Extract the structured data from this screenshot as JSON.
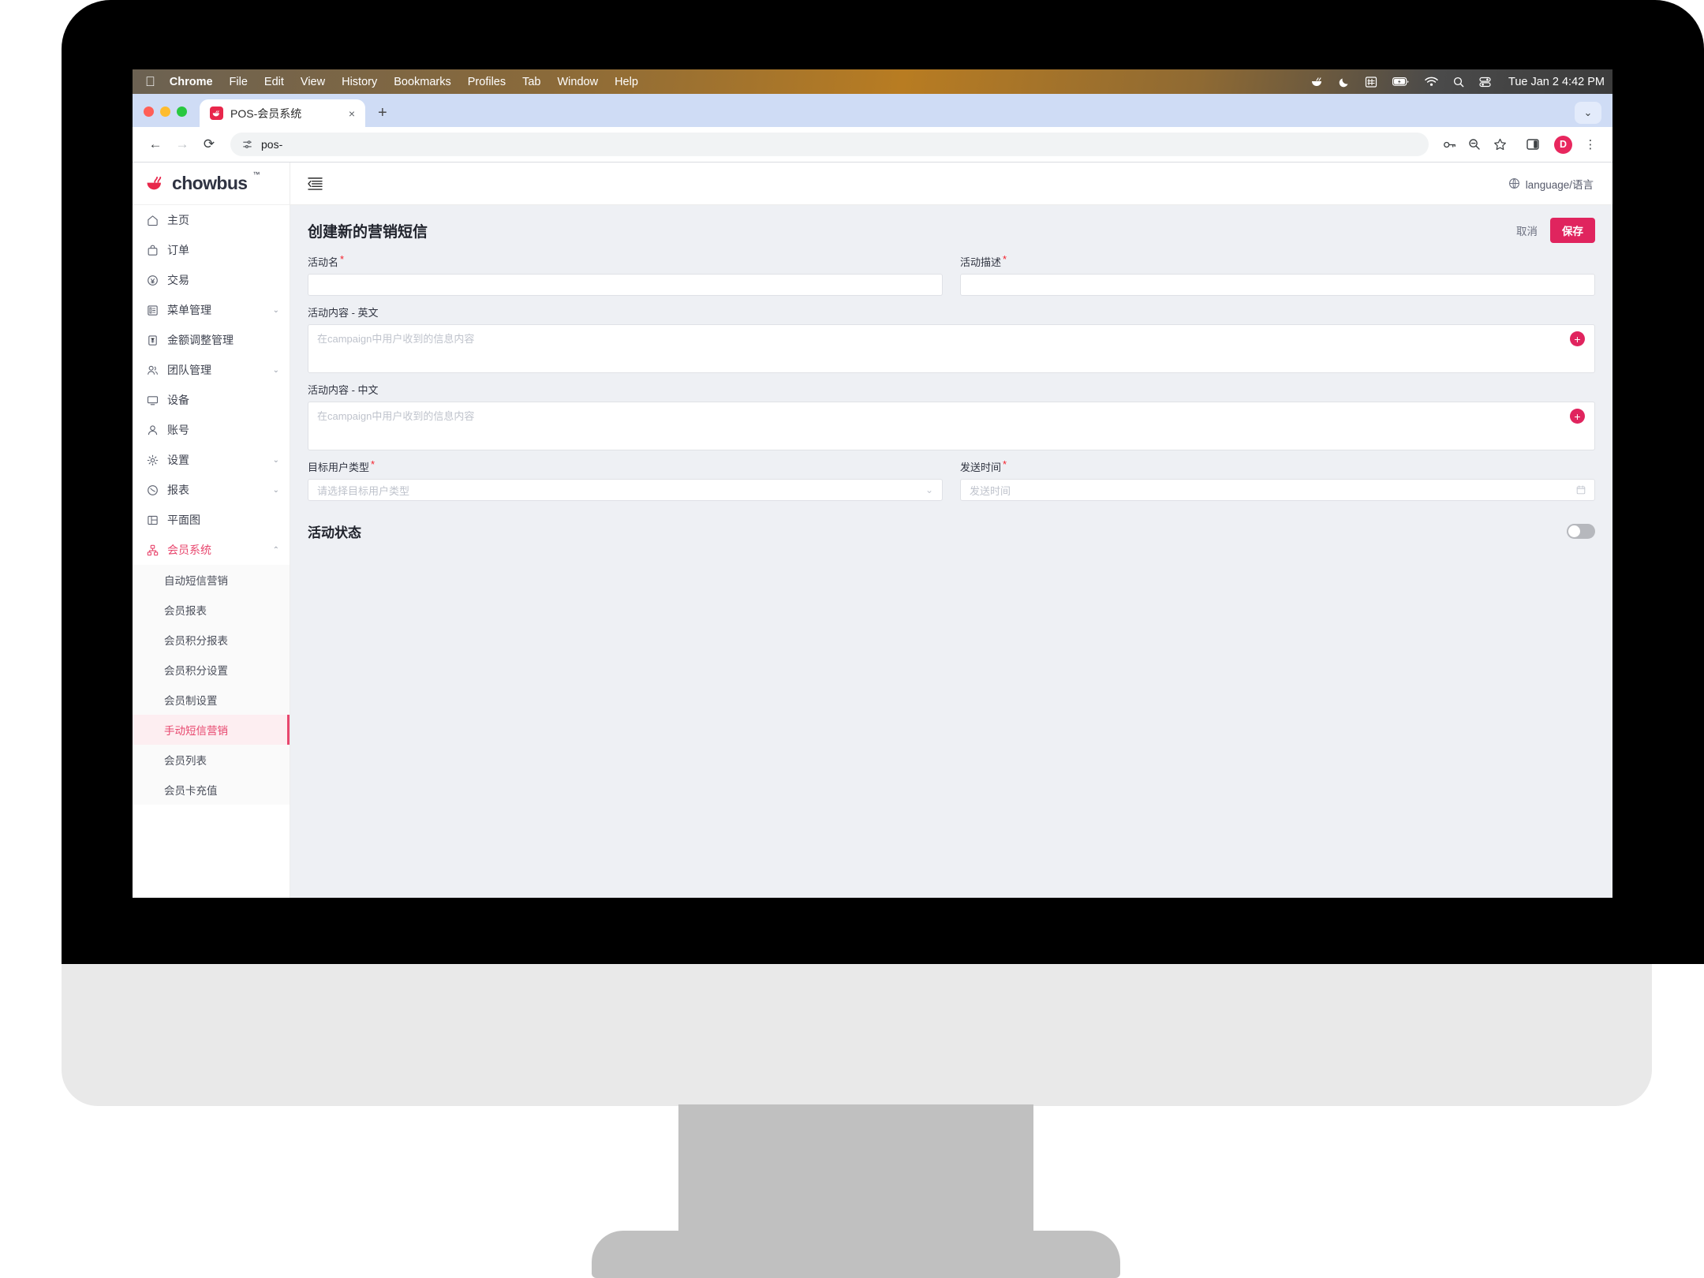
{
  "menubar": {
    "apple": "",
    "items": [
      "Chrome",
      "File",
      "Edit",
      "View",
      "History",
      "Bookmarks",
      "Profiles",
      "Tab",
      "Window",
      "Help"
    ],
    "status_icons": [
      "chowbus-menu-icon",
      "moon-icon",
      "input-source-icon",
      "battery-icon",
      "wifi-icon",
      "search-icon",
      "control-center-icon"
    ],
    "clock": "Tue Jan 2  4:42 PM"
  },
  "browser": {
    "tab": {
      "title": "POS-会员系统",
      "favicon": "chowbus-favicon",
      "close": "×"
    },
    "new_tab": "+",
    "tab_list_chevron": "⌄",
    "toolbar": {
      "back": "←",
      "forward": "→",
      "reload": "⟳",
      "site_info": "site-settings-icon",
      "url": "pos-",
      "password_icon": "key-icon",
      "zoom_icon": "zoom-out-icon",
      "bookmark_icon": "star-icon",
      "sidepanel_icon": "side-panel-icon",
      "avatar_letter": "D",
      "menu_icon": "⋮"
    }
  },
  "sidebar": {
    "logo": {
      "mark": "chowbus-bowl-icon",
      "word": "chowbus",
      "tm": "™"
    },
    "items": [
      {
        "label": "主页",
        "icon": "home-icon",
        "chevron": "",
        "active": false
      },
      {
        "label": "订单",
        "icon": "bag-icon",
        "chevron": "",
        "active": false
      },
      {
        "label": "交易",
        "icon": "transaction-icon",
        "chevron": "",
        "active": false
      },
      {
        "label": "菜单管理",
        "icon": "menu-list-icon",
        "chevron": "⌄",
        "active": false
      },
      {
        "label": "金额调整管理",
        "icon": "yuan-icon",
        "chevron": "",
        "active": false
      },
      {
        "label": "团队管理",
        "icon": "team-icon",
        "chevron": "⌄",
        "active": false
      },
      {
        "label": "设备",
        "icon": "monitor-icon",
        "chevron": "",
        "active": false
      },
      {
        "label": "账号",
        "icon": "user-icon",
        "chevron": "",
        "active": false
      },
      {
        "label": "设置",
        "icon": "gear-icon",
        "chevron": "⌄",
        "active": false
      },
      {
        "label": "报表",
        "icon": "report-icon",
        "chevron": "⌄",
        "active": false
      },
      {
        "label": "平面图",
        "icon": "layout-icon",
        "chevron": "",
        "active": false
      },
      {
        "label": "会员系统",
        "icon": "membership-icon",
        "chevron": "⌃",
        "active": true
      }
    ],
    "submenu": [
      {
        "label": "自动短信营销",
        "active": false
      },
      {
        "label": "会员报表",
        "active": false
      },
      {
        "label": "会员积分报表",
        "active": false
      },
      {
        "label": "会员积分设置",
        "active": false
      },
      {
        "label": "会员制设置",
        "active": false
      },
      {
        "label": "手动短信营销",
        "active": true
      },
      {
        "label": "会员列表",
        "active": false
      },
      {
        "label": "会员卡充值",
        "active": false
      }
    ]
  },
  "app_header": {
    "collapse_icon": "collapse-sidebar-icon",
    "language": "language/语言",
    "globe_icon": "globe-icon"
  },
  "form": {
    "page_title": "创建新的营销短信",
    "cancel_label": "取消",
    "save_label": "保存",
    "campaign_name": {
      "label": "活动名",
      "required": "*",
      "value": "",
      "placeholder": ""
    },
    "campaign_desc": {
      "label": "活动描述",
      "required": "*",
      "value": "",
      "placeholder": ""
    },
    "content_en": {
      "label": "活动内容 - 英文",
      "placeholder": "在campaign中用户收到的信息内容",
      "value": "",
      "add_icon": "+"
    },
    "content_zh": {
      "label": "活动内容 - 中文",
      "placeholder": "在campaign中用户收到的信息内容",
      "value": "",
      "add_icon": "+"
    },
    "target_type": {
      "label": "目标用户类型",
      "required": "*",
      "placeholder": "请选择目标用户类型",
      "value": "",
      "chevron": "⌄"
    },
    "send_time": {
      "label": "发送时间",
      "required": "*",
      "placeholder": "发送时间",
      "value": "",
      "icon": "calendar-icon"
    },
    "status": {
      "label": "活动状态",
      "toggle_on": false
    }
  },
  "colors": {
    "brand_pink": "#e0245e",
    "active_pink": "#e8476e",
    "active_bg": "#fdeef1",
    "page_bg": "#eef0f4"
  }
}
